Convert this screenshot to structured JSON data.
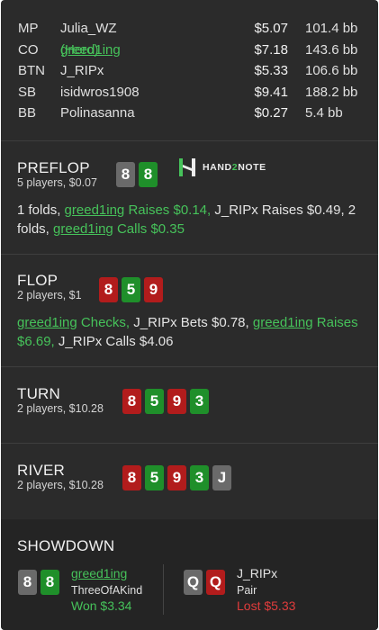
{
  "players": [
    {
      "pos": "MP",
      "name": "Julia_WZ",
      "stack": "$5.07",
      "bb": "101.4 bb"
    },
    {
      "pos": "CO",
      "name": "greed1ing",
      "name_suffix": "(Hero)",
      "stack": "$7.18",
      "bb": "143.6 bb"
    },
    {
      "pos": "BTN",
      "name": "J_RIPx",
      "stack": "$5.33",
      "bb": "106.6 bb"
    },
    {
      "pos": "SB",
      "name": "isidwros1908",
      "stack": "$9.41",
      "bb": "188.2 bb"
    },
    {
      "pos": "BB",
      "name": "Polinasanna",
      "stack": "$0.27",
      "bb": "5.4 bb"
    }
  ],
  "logo": {
    "pre": "HAND",
    "two": "2",
    "post": "NOTE"
  },
  "preflop": {
    "title": "PREFLOP",
    "sub": "5 players, $0.07",
    "cards": [
      {
        "rank": "8",
        "color": "gray"
      },
      {
        "rank": "8",
        "color": "green"
      }
    ],
    "a1": "1 folds,",
    "a2": "greed1ing",
    "a3": "Raises $0.14,",
    "a4": "J_RIPx",
    "a5": "Raises $0.49,",
    "a6": "2 folds,",
    "a7": "greed1ing",
    "a8": "Calls $0.35"
  },
  "flop": {
    "title": "FLOP",
    "sub": "2 players, $1",
    "cards": [
      {
        "rank": "8",
        "color": "red"
      },
      {
        "rank": "5",
        "color": "green"
      },
      {
        "rank": "9",
        "color": "red"
      }
    ],
    "a1": "greed1ing",
    "a2": "Checks,",
    "a3": "J_RIPx",
    "a4": "Bets $0.78,",
    "a5": "greed1ing",
    "a6": "Raises",
    "a7": "$6.69,",
    "a8": "J_RIPx",
    "a9": "Calls $4.06"
  },
  "turn": {
    "title": "TURN",
    "sub": "2 players, $10.28",
    "cards": [
      {
        "rank": "8",
        "color": "red"
      },
      {
        "rank": "5",
        "color": "green"
      },
      {
        "rank": "9",
        "color": "red"
      },
      {
        "rank": "3",
        "color": "green"
      }
    ]
  },
  "river": {
    "title": "RIVER",
    "sub": "2 players, $10.28",
    "cards": [
      {
        "rank": "8",
        "color": "red"
      },
      {
        "rank": "5",
        "color": "green"
      },
      {
        "rank": "9",
        "color": "red"
      },
      {
        "rank": "3",
        "color": "green"
      },
      {
        "rank": "J",
        "color": "gray"
      }
    ]
  },
  "showdown": {
    "title": "SHOWDOWN",
    "hero": {
      "name": "greed1ing",
      "hand": "ThreeOfAKind",
      "result": "Won $3.34",
      "cards": [
        {
          "rank": "8",
          "color": "gray"
        },
        {
          "rank": "8",
          "color": "green"
        }
      ]
    },
    "villain": {
      "name": "J_RIPx",
      "hand": "Pair",
      "result": "Lost $5.33",
      "cards": [
        {
          "rank": "Q",
          "color": "gray"
        },
        {
          "rank": "Q",
          "color": "red"
        }
      ]
    }
  },
  "colors": {
    "red_card": "#b21c1c",
    "green_card": "#1f8f2a",
    "gray_card": "#6a6a6a",
    "hero_green": "#46c25a",
    "lost_red": "#e03c3c",
    "background": "#2b2b2b"
  }
}
